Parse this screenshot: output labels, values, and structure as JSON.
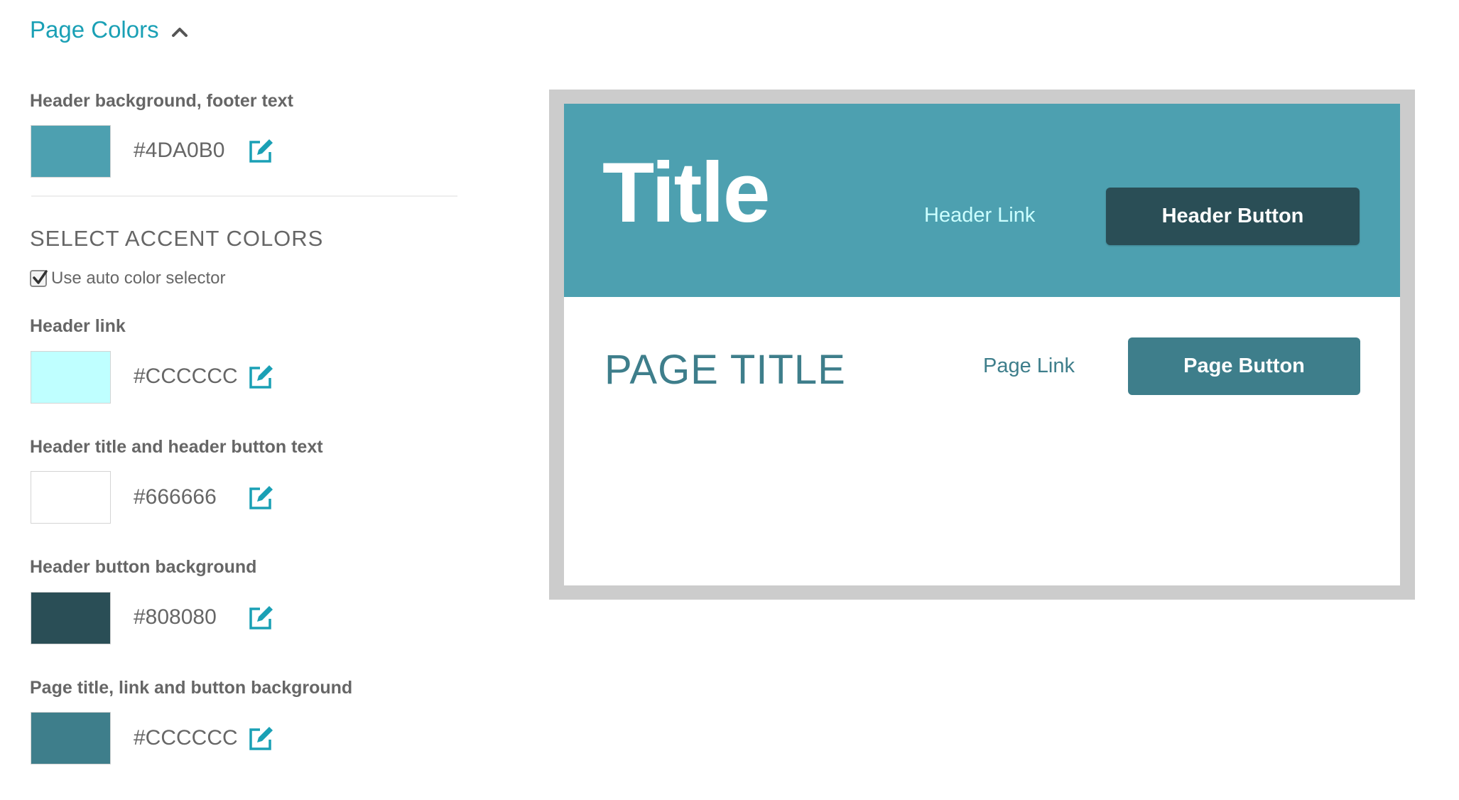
{
  "section": {
    "title": "Page Colors",
    "toggle_icon": "chevron-up-icon"
  },
  "fields": [
    {
      "label": "Header background, footer text",
      "swatch_color": "#4DA0B0",
      "hex": "#4DA0B0",
      "icon": "edit-icon"
    },
    {
      "label": "Header link",
      "swatch_color": "#BFFFFF",
      "hex": "#CCCCCC",
      "icon": "edit-icon"
    },
    {
      "label": "Header title and header button text",
      "swatch_color": "#FFFFFF",
      "hex": "#666666",
      "icon": "edit-icon"
    },
    {
      "label": "Header button background",
      "swatch_color": "#2A4E56",
      "hex": "#808080",
      "icon": "edit-icon"
    },
    {
      "label": "Page title, link and button background",
      "swatch_color": "#3E7E8B",
      "hex": "#CCCCCC",
      "icon": "edit-icon"
    }
  ],
  "accent": {
    "heading": "SELECT ACCENT COLORS",
    "auto_selector_label": "Use auto color selector",
    "auto_selector_checked": true
  },
  "preview": {
    "title": "Title",
    "header_link": "Header Link",
    "header_button": "Header Button",
    "page_title": "PAGE TITLE",
    "page_link": "Page Link",
    "page_button": "Page Button"
  },
  "colors": {
    "accent_link": "#1AA0B5",
    "header_bg": "#4DA0B0",
    "header_link": "#CCFFFF",
    "header_button_bg": "#2A4E56",
    "page_accent": "#3E7E8B",
    "frame": "#CCCCCC"
  }
}
